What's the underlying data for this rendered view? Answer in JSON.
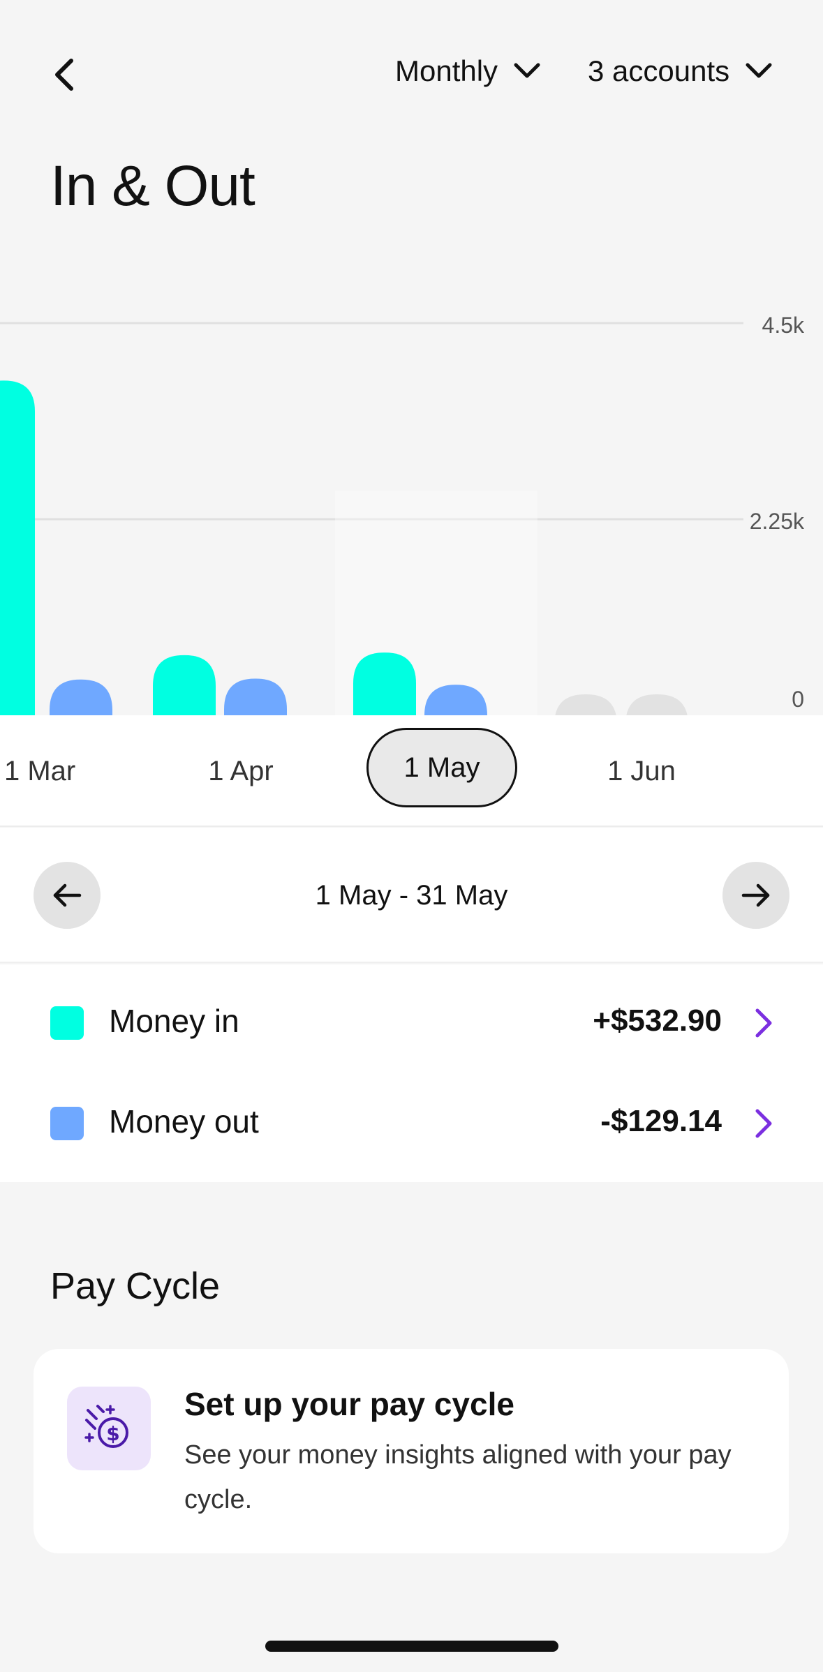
{
  "header": {
    "period_label": "Monthly",
    "accounts_label": "3 accounts"
  },
  "page": {
    "title": "In & Out"
  },
  "chart_data": {
    "type": "bar",
    "categories": [
      "1 Mar",
      "1 Apr",
      "1 May",
      "1 Jun"
    ],
    "series": [
      {
        "name": "Money in",
        "values": [
          3840,
          690,
          720,
          200
        ]
      },
      {
        "name": "Money out",
        "values": [
          410,
          420,
          350,
          200
        ]
      }
    ],
    "ylim": [
      0,
      4500
    ],
    "yticks": [
      "0",
      "2.25k",
      "4.5k"
    ],
    "selected_category": "1 May",
    "colors": {
      "money_in": "#00ffe1",
      "money_out": "#6fa8ff",
      "future": "#e2e2e2",
      "grid": "#e0e0e0"
    }
  },
  "months": {
    "items": [
      "1 Mar",
      "1 Apr",
      "1 May",
      "1 Jun"
    ],
    "selected": "1 May"
  },
  "range": {
    "text": "1 May - 31 May"
  },
  "summary": {
    "money_in_label": "Money in",
    "money_in_amount": "+$532.90",
    "money_out_label": "Money out",
    "money_out_amount": "-$129.14"
  },
  "pay_cycle": {
    "section_title": "Pay Cycle",
    "card_title": "Set up your pay cycle",
    "card_body": "See your money insights aligned with your pay cycle."
  },
  "colors": {
    "accent_purple": "#7b2fe0",
    "icon_bg": "#ede4fb"
  }
}
